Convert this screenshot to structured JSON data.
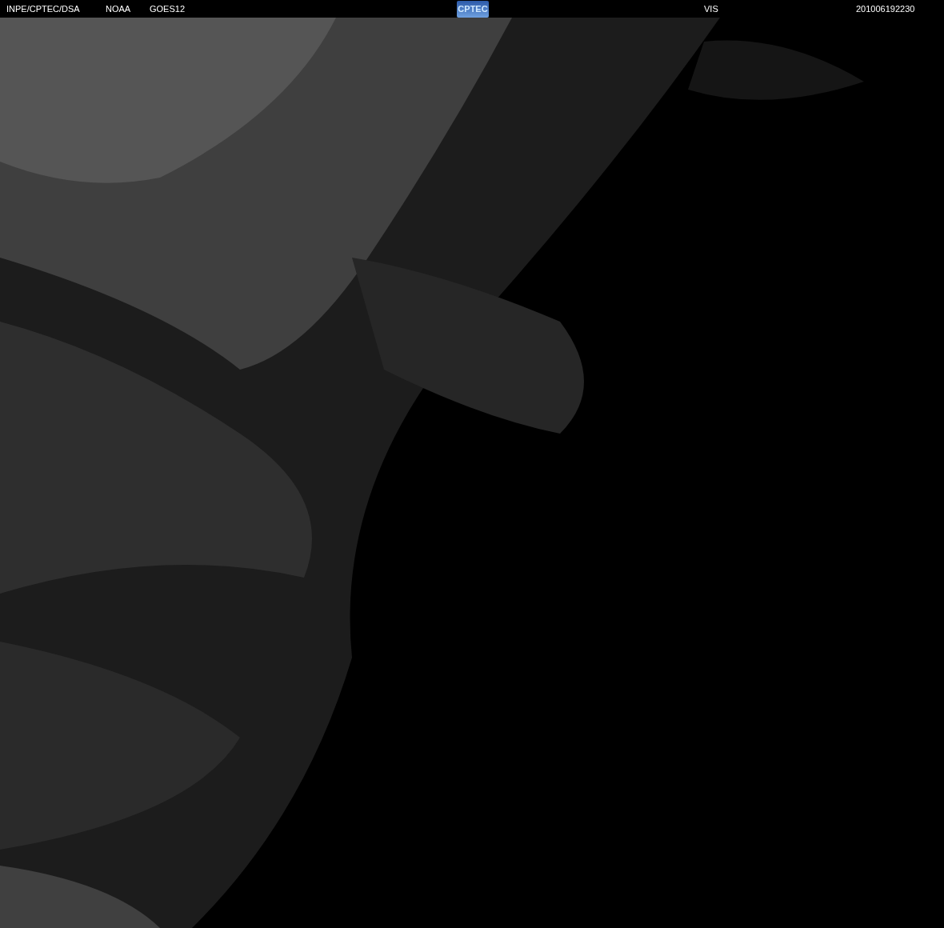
{
  "header": {
    "labels": [
      "INPE/CPTEC/DSA",
      "NOAA",
      "GOES12"
    ],
    "logo": "CPTEC",
    "channel": "VIS",
    "timestamp": "201006192230"
  }
}
